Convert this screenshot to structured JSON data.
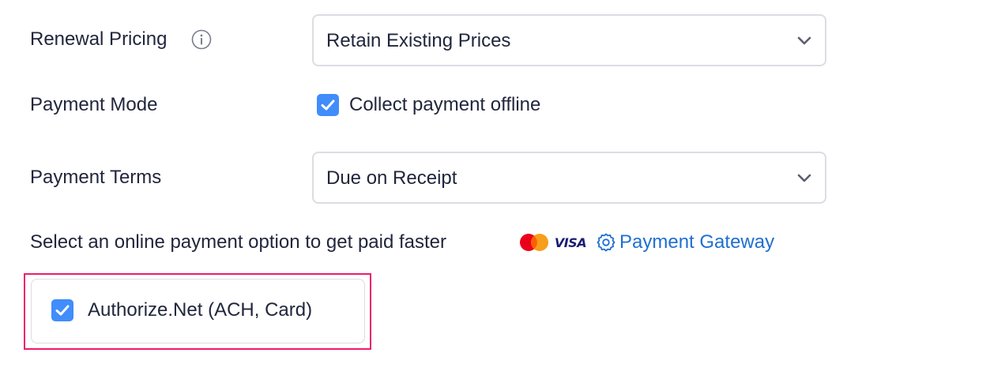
{
  "renewal_pricing": {
    "label": "Renewal Pricing",
    "info_icon": "info-circle-icon",
    "selected_value": "Retain Existing Prices"
  },
  "payment_mode": {
    "label": "Payment Mode",
    "checkbox_label": "Collect payment offline",
    "checked": true
  },
  "payment_terms": {
    "label": "Payment Terms",
    "selected_value": "Due on Receipt"
  },
  "online_payment": {
    "prompt": "Select an online payment option to get paid faster",
    "card_icons": [
      "mastercard-icon",
      "visa-icon"
    ],
    "gateway_link_label": "Payment Gateway",
    "gateway_icon": "gear-icon"
  },
  "gateway_option": {
    "label": "Authorize.Net (ACH, Card)",
    "checked": true
  },
  "colors": {
    "text": "#21263c",
    "checkbox": "#408dfb",
    "link": "#1f6fd1",
    "highlight": "#ec1c6c",
    "border": "#dcdde3"
  }
}
